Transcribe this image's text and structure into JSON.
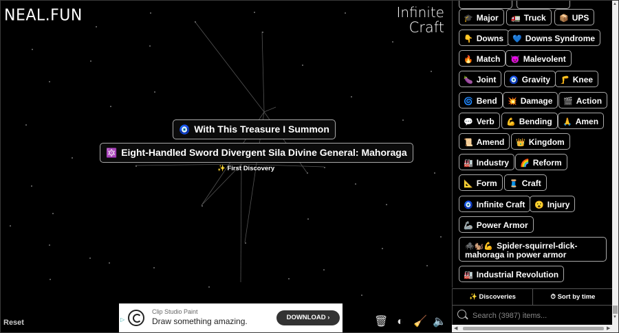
{
  "logo": "NEAL.FUN",
  "brand": {
    "line1": "Infinite",
    "line2": "Craft"
  },
  "canvas": {
    "elements": [
      {
        "emoji": "🧿",
        "label": "With This Treasure I Summon"
      },
      {
        "emoji": "🔯",
        "label": "Eight-Handled Sword Divergent Sila Divine General: Mahoraga"
      }
    ],
    "first_discovery": "✨ First Discovery",
    "reset": "Reset"
  },
  "ad": {
    "brand": "Clip Studio Paint",
    "tagline": "Draw something amazing.",
    "button": "DOWNLOAD ›",
    "adchoices": "▷"
  },
  "tools": {
    "trash": "🗑",
    "moon": "◐",
    "broom": "🧹",
    "sound": "🔈"
  },
  "sidebar": {
    "items": [
      {
        "emoji": "🎓",
        "label": "Major"
      },
      {
        "emoji": "🚛",
        "label": "Truck"
      },
      {
        "emoji": "📦",
        "label": "UPS"
      },
      {
        "emoji": "👇",
        "label": "Downs"
      },
      {
        "emoji": "💙",
        "label": "Downs Syndrome"
      },
      {
        "emoji": "🔥",
        "label": "Match"
      },
      {
        "emoji": "😈",
        "label": "Malevolent"
      },
      {
        "emoji": "🍆",
        "label": "Joint"
      },
      {
        "emoji": "🧿",
        "label": "Gravity"
      },
      {
        "emoji": "🦵",
        "label": "Knee"
      },
      {
        "emoji": "🌀",
        "label": "Bend"
      },
      {
        "emoji": "💥",
        "label": "Damage"
      },
      {
        "emoji": "🎬",
        "label": "Action"
      },
      {
        "emoji": "💬",
        "label": "Verb"
      },
      {
        "emoji": "💪",
        "label": "Bending"
      },
      {
        "emoji": "🙏",
        "label": "Amen"
      },
      {
        "emoji": "📜",
        "label": "Amend"
      },
      {
        "emoji": "👑",
        "label": "Kingdom"
      },
      {
        "emoji": "🏭",
        "label": "Industry"
      },
      {
        "emoji": "🌈",
        "label": "Reform"
      },
      {
        "emoji": "📐",
        "label": "Form"
      },
      {
        "emoji": "🧵",
        "label": "Craft"
      },
      {
        "emoji": "🧿",
        "label": "Infinite Craft"
      },
      {
        "emoji": "😮",
        "label": "Injury"
      },
      {
        "emoji": "🦾",
        "label": "Power Armor"
      },
      {
        "emoji": "🕷️🐿️💪",
        "label": "Spider-squirrel-dick-mahoraga in power armor"
      },
      {
        "emoji": "🏭",
        "label": "Industrial Revolution"
      }
    ],
    "tabs": {
      "discoveries": "✨ Discoveries",
      "sort": "⏱ Sort by time"
    },
    "search_placeholder": "Search (3987) items..."
  }
}
